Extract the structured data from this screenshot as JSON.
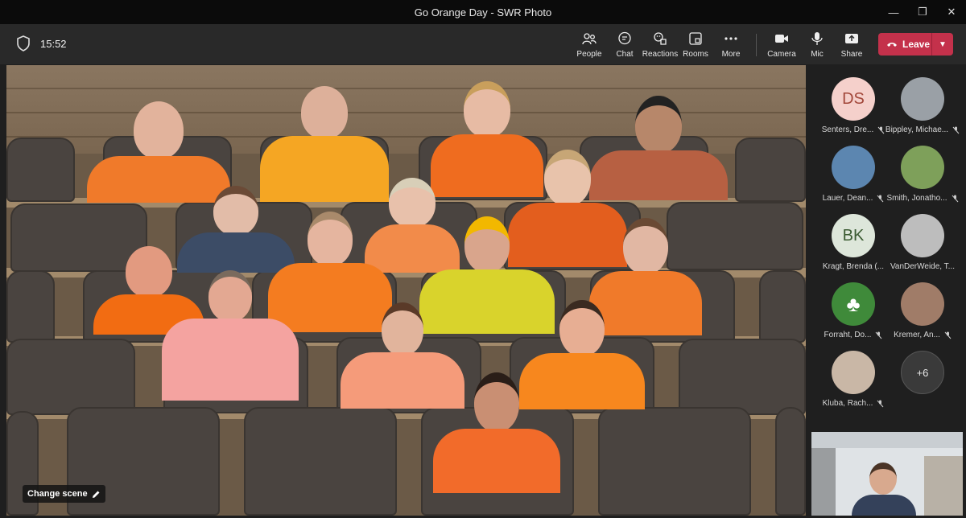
{
  "window": {
    "title": "Go Orange Day - SWR Photo"
  },
  "toolbar": {
    "time": "15:52",
    "buttons": {
      "people": "People",
      "chat": "Chat",
      "reactions": "Reactions",
      "rooms": "Rooms",
      "more": "More",
      "camera": "Camera",
      "mic": "Mic",
      "share": "Share"
    },
    "leave_label": "Leave"
  },
  "stage": {
    "change_scene_label": "Change scene"
  },
  "participants": [
    {
      "name": "Senters, Dre...",
      "initials": "DS",
      "muted": true
    },
    {
      "name": "Bippley, Michae...",
      "initials": "",
      "muted": true
    },
    {
      "name": "Lauer, Dean...",
      "initials": "",
      "muted": true
    },
    {
      "name": "Smith, Jonatho...",
      "initials": "",
      "muted": true
    },
    {
      "name": "Kragt, Brenda (...",
      "initials": "BK",
      "muted": false
    },
    {
      "name": "VanDerWeide, T...",
      "initials": "",
      "muted": false
    },
    {
      "name": "Forraht, Do...",
      "initials": "",
      "muted": true
    },
    {
      "name": "Kremer, An...",
      "initials": "",
      "muted": true
    },
    {
      "name": "Kluba, Rach...",
      "initials": "",
      "muted": true
    }
  ],
  "overflow_count": "+6",
  "colors": {
    "leave": "#c4314b",
    "ds_avatar": "#f5d0cb",
    "bk_avatar": "#dde6da",
    "orange_shirt": "#f07a2a"
  }
}
